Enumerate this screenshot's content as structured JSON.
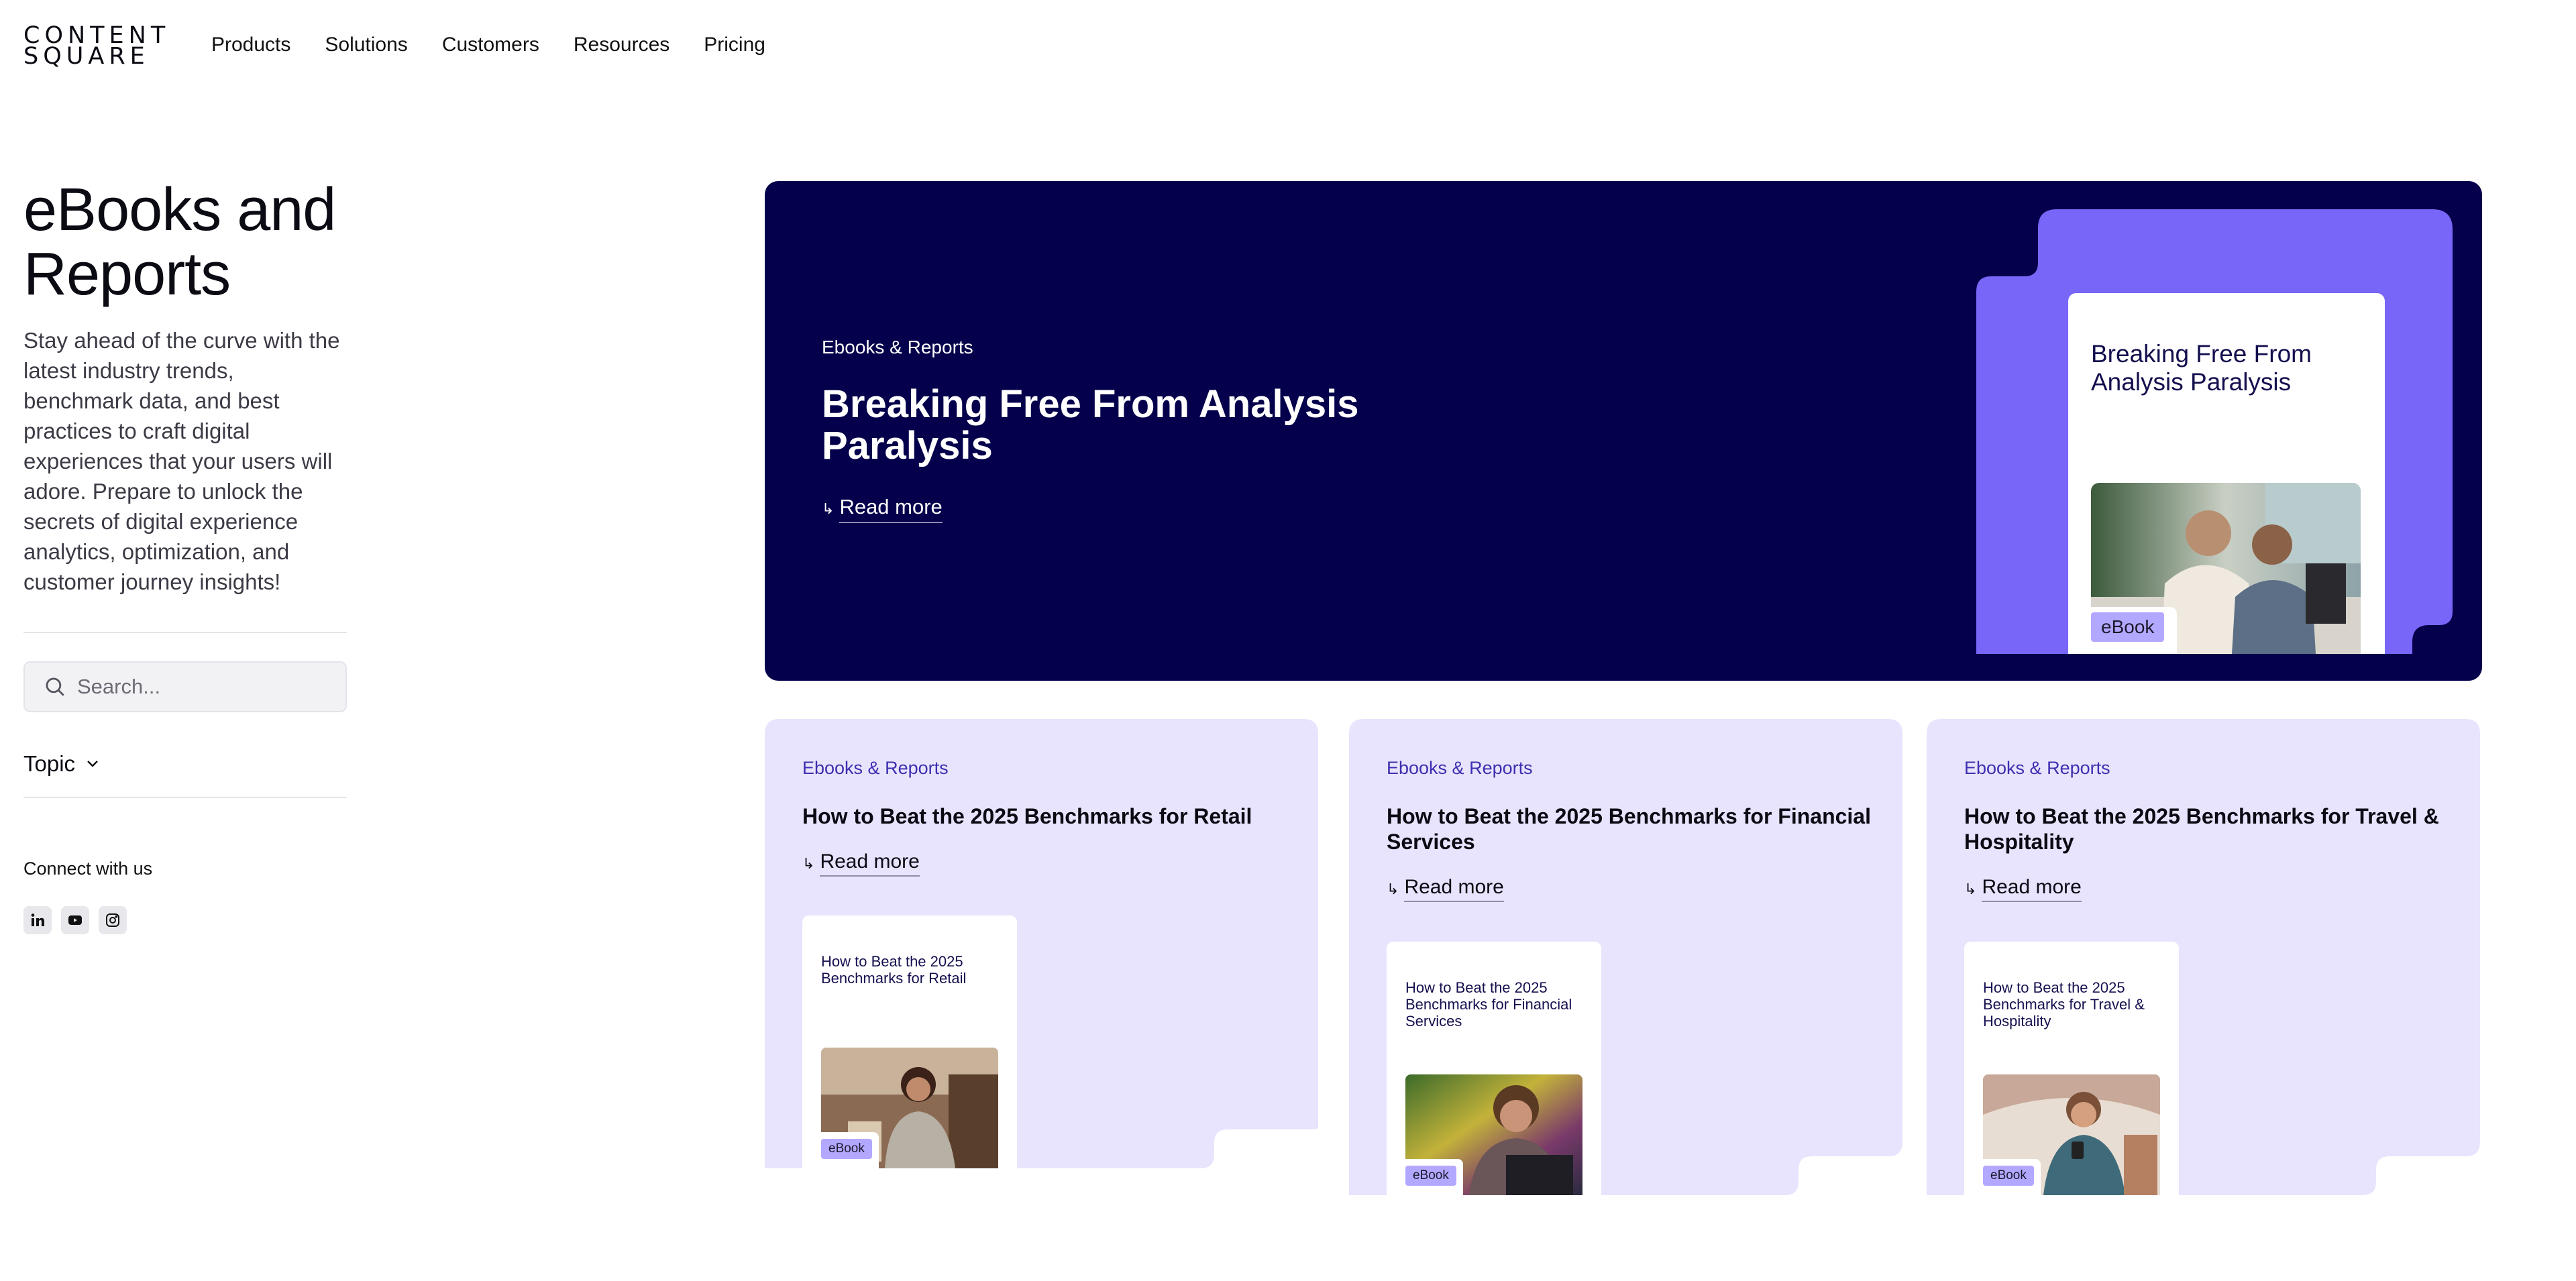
{
  "brand": {
    "logo_line1": "CONTENT",
    "logo_line2": "SQUARE"
  },
  "nav": {
    "items": [
      "Products",
      "Solutions",
      "Customers",
      "Resources",
      "Pricing"
    ]
  },
  "sidebar": {
    "title": "eBooks and Reports",
    "intro": "Stay ahead of the curve with the latest industry trends, benchmark data, and best practices to craft digital experiences that your users will adore. Prepare to unlock the secrets of digital experience analytics, optimization, and customer journey insights!",
    "search_placeholder": "Search...",
    "topic_label": "Topic",
    "connect_label": "Connect with us",
    "socials": [
      "linkedin-icon",
      "youtube-icon",
      "instagram-icon"
    ]
  },
  "hero": {
    "category": "Ebooks & Reports",
    "title": "Breaking Free From Analysis Paralysis",
    "read_more": "Read more",
    "book_title": "Breaking Free From Analysis Paralysis",
    "badge": "eBook"
  },
  "cards": [
    {
      "category": "Ebooks & Reports",
      "title": "How to Beat the 2025 Benchmarks for Retail",
      "read_more": "Read more",
      "book_title": "How to Beat the 2025 Benchmarks for Retail",
      "badge": "eBook"
    },
    {
      "category": "Ebooks & Reports",
      "title": "How to Beat the 2025 Benchmarks for Financial Services",
      "read_more": "Read more",
      "book_title": "How to Beat the 2025 Benchmarks for Financial Services",
      "badge": "eBook"
    },
    {
      "category": "Ebooks & Reports",
      "title": "How to Beat the 2025 Benchmarks for Travel & Hospitality",
      "read_more": "Read more",
      "book_title": "How to Beat the 2025 Benchmarks for Travel & Hospitality",
      "badge": "eBook"
    }
  ],
  "colors": {
    "hero_bg": "#04004b",
    "accent_purple": "#7766f7",
    "card_bg": "#e8e4fd",
    "badge_bg": "#b3a8ff"
  }
}
